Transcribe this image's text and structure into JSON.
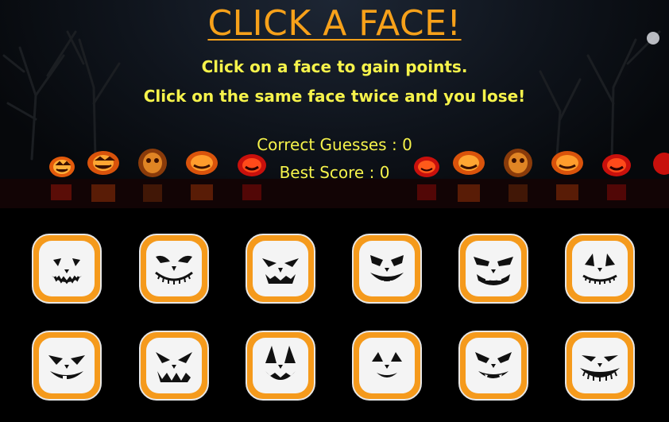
{
  "header": {
    "title": "CLICK A FACE!",
    "instruction_line1": "Click on a face to gain points.",
    "instruction_line2": "Click on the same face twice and you lose!"
  },
  "scoreboard": {
    "correct_label": "Correct Guesses : ",
    "correct_value": "0",
    "best_label": "Best Score : ",
    "best_value": "0"
  },
  "colors": {
    "title": "#f7a11a",
    "text": "#f6f34b",
    "card_border": "#f59a1c",
    "card_face": "#f4f4f4"
  },
  "faces": [
    {
      "name": "face-1",
      "icon": "jack-o-lantern-grin-icon"
    },
    {
      "name": "face-2",
      "icon": "jack-o-lantern-stitched-smile-icon"
    },
    {
      "name": "face-3",
      "icon": "jack-o-lantern-angry-icon"
    },
    {
      "name": "face-4",
      "icon": "jack-o-lantern-fanged-icon"
    },
    {
      "name": "face-5",
      "icon": "jack-o-lantern-scowl-icon"
    },
    {
      "name": "face-6",
      "icon": "jack-o-lantern-triangle-eyes-icon"
    },
    {
      "name": "face-7",
      "icon": "jack-o-lantern-gap-tooth-icon"
    },
    {
      "name": "face-8",
      "icon": "jack-o-lantern-zigzag-icon"
    },
    {
      "name": "face-9",
      "icon": "jack-o-lantern-tall-eyes-icon"
    },
    {
      "name": "face-10",
      "icon": "jack-o-lantern-small-smile-icon"
    },
    {
      "name": "face-11",
      "icon": "jack-o-lantern-fanged-grin-icon"
    },
    {
      "name": "face-12",
      "icon": "jack-o-lantern-wicked-grin-icon"
    }
  ]
}
